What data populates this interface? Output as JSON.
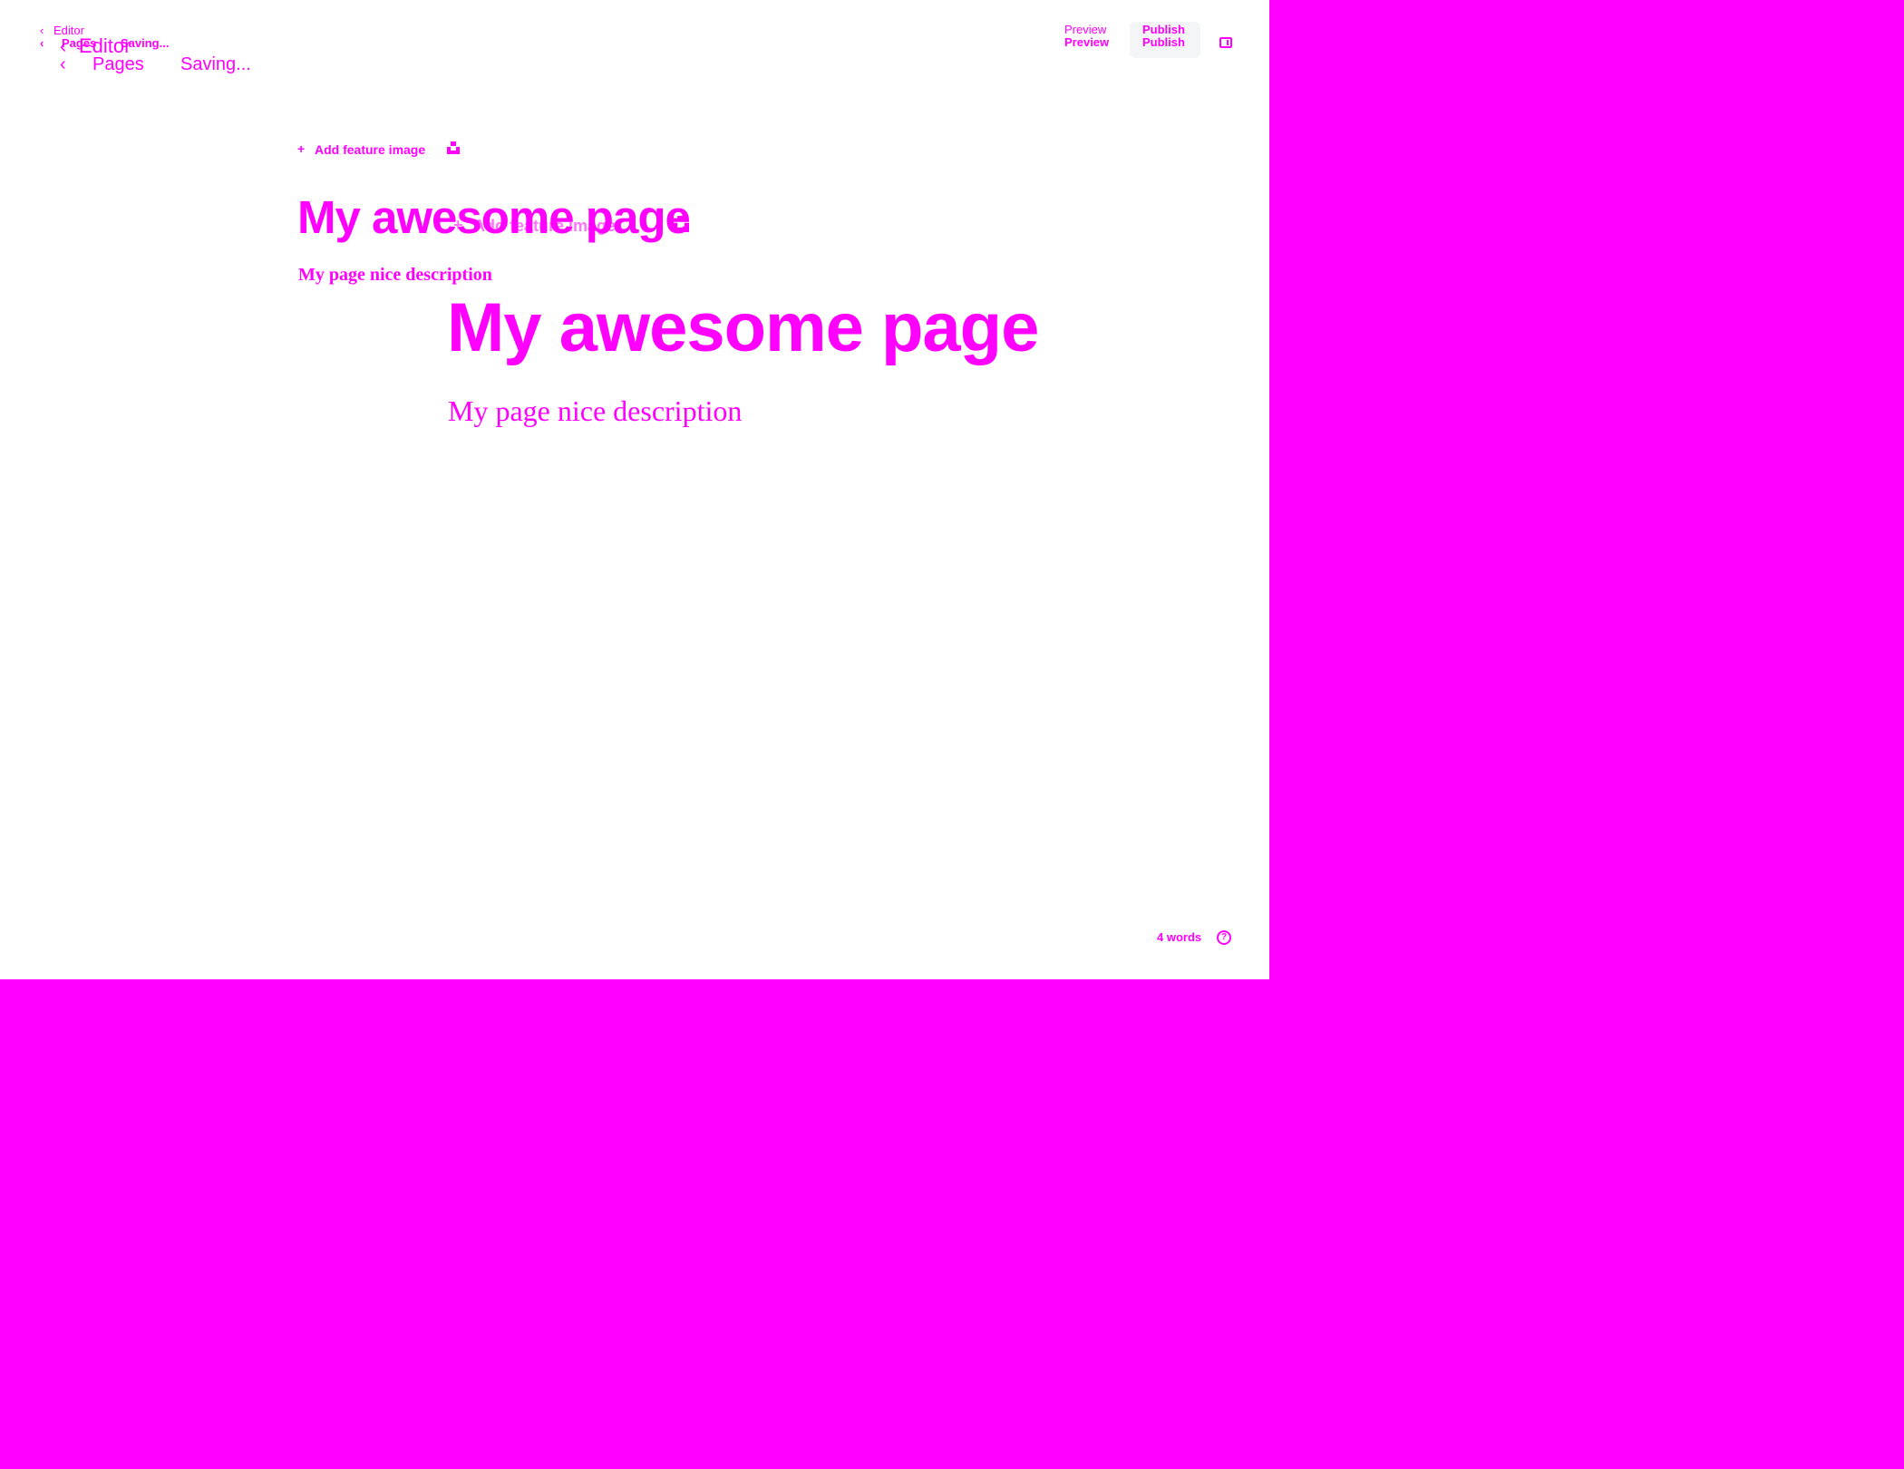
{
  "nav": {
    "back_editor": "Editor",
    "pages": "Pages",
    "status": "Saving...",
    "back_chevron": "‹"
  },
  "toolbar": {
    "preview": "Preview",
    "publish": "Publish"
  },
  "editor": {
    "add_feature_image": "Add feature image",
    "title": "My awesome page",
    "description": "My page nice description"
  },
  "footer": {
    "word_count": "4 words",
    "help_glyph": "?"
  },
  "icons": {
    "back": "chevron-left-icon",
    "add": "plus-icon",
    "unsplash": "unsplash-icon",
    "sidebar": "sidebar-toggle-icon",
    "help": "help-icon"
  },
  "colors": {
    "accent": "#ff00ff",
    "canvas": "#ffffff",
    "publish_bg": "#f4f5f6"
  }
}
